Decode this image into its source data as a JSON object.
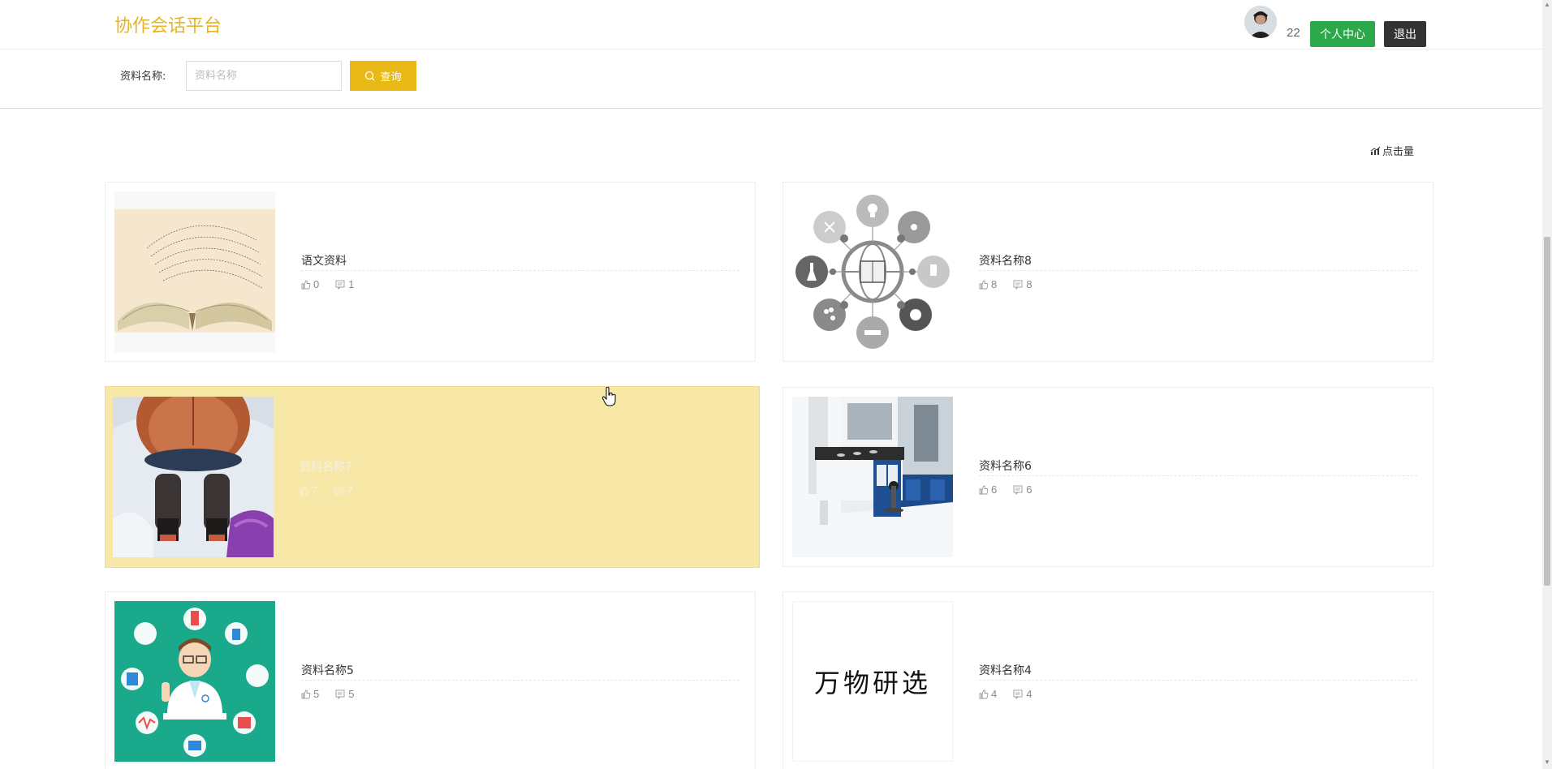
{
  "header": {
    "brand": "协作会话平台",
    "count": "22",
    "personal_center_label": "个人中心",
    "logout_label": "退出"
  },
  "search": {
    "label": "资料名称:",
    "placeholder": "资料名称",
    "button_label": "查询"
  },
  "sort": {
    "label": "点击量"
  },
  "cards": [
    {
      "title": "语文资料",
      "likes": "0",
      "comments": "1",
      "image": "open-book"
    },
    {
      "title": "资料名称8",
      "likes": "8",
      "comments": "8",
      "image": "science-icons-circle"
    },
    {
      "title": "资料名称7",
      "likes": "7",
      "comments": "7",
      "image": "microscope-researcher"
    },
    {
      "title": "资料名称6",
      "likes": "6",
      "comments": "6",
      "image": "laboratory-room"
    },
    {
      "title": "资料名称5",
      "likes": "5",
      "comments": "5",
      "image": "doctor-illustration"
    },
    {
      "title": "资料名称4",
      "likes": "4",
      "comments": "4",
      "image": "brand-text",
      "image_text": "万物研选"
    }
  ],
  "colors": {
    "brand": "#e6b521",
    "search_button": "#e9ba16",
    "personal_center": "#2aa84a",
    "logout": "#333333",
    "card_hover": "#f8e8a8"
  }
}
